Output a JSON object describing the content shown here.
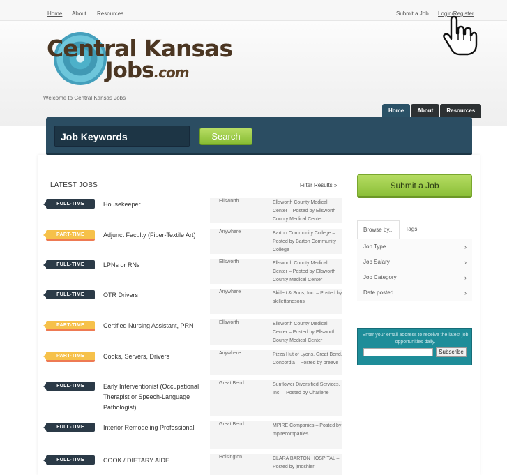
{
  "top_nav": {
    "home": "Home",
    "about": "About",
    "resources": "Resources",
    "submit_job": "Submit a Job",
    "login_register": "Login/Register"
  },
  "logo": {
    "line1": "Central Kansas",
    "line2": "Jobs",
    "suffix": ".com"
  },
  "welcome": "Welcome to Central Kansas Jobs",
  "tabs": {
    "home": "Home",
    "about": "About",
    "resources": "Resources"
  },
  "search": {
    "placeholder": "Job Keywords",
    "button": "Search"
  },
  "latest_jobs": {
    "heading": "LATEST JOBS",
    "filter": "Filter Results »"
  },
  "jobs": [
    {
      "type": "FULL-TIME",
      "title": "Housekeeper",
      "location": "Ellsworth",
      "meta": "Ellsworth County Medical Center – Posted by Ellsworth County Medical Center"
    },
    {
      "type": "PART-TIME",
      "title": "Adjunct Faculty (Fiber-Textile Art)",
      "location": "Anywhere",
      "meta": "Barton Community College – Posted by Barton Community College"
    },
    {
      "type": "FULL-TIME",
      "title": "LPNs or RNs",
      "location": "Ellsworth",
      "meta": "Ellsworth County Medical Center – Posted by Ellsworth County Medical Center"
    },
    {
      "type": "FULL-TIME",
      "title": "OTR Drivers",
      "location": "Anywhere",
      "meta": "Skillett & Sons, Inc. – Posted by skillettandsons"
    },
    {
      "type": "PART-TIME",
      "title": "Certified Nursing Assistant, PRN",
      "location": "Ellsworth",
      "meta": "Ellsworth County Medical Center – Posted by Ellsworth County Medical Center"
    },
    {
      "type": "PART-TIME",
      "title": "Cooks, Servers, Drivers",
      "location": "Anywhere",
      "meta": "Pizza Hut of Lyons, Great Bend, Concordia – Posted by preeve"
    },
    {
      "type": "FULL-TIME",
      "title": "Early Interventionist (Occupational Therapist or Speech-Language Pathologist)",
      "location": "Great Bend",
      "meta": "Sunflower Diversified Services, Inc. – Posted by Charlene"
    },
    {
      "type": "FULL-TIME",
      "title": "Interior Remodeling Professional",
      "location": "Great Bend",
      "meta": "MPIRE Companies – Posted by mpirecompanies"
    },
    {
      "type": "FULL-TIME",
      "title": "COOK / DIETARY AIDE",
      "location": "Hoisington",
      "meta": "CLARA BARTON HOSPITAL – Posted by jmoshier"
    }
  ],
  "sidebar": {
    "submit_button": "Submit a Job",
    "browse_tab": "Browse by...",
    "tags_tab": "Tags",
    "browse_items": [
      "Job Type",
      "Job Salary",
      "Job Category",
      "Date posted"
    ],
    "chevron": "›",
    "newsletter_text": "Enter your email address to receive the latest job opportunities daily.",
    "subscribe": "Subscribe"
  },
  "icons": {
    "cursor": "hand-pointer-icon",
    "flower": "flower-logo-icon"
  },
  "colors": {
    "search_bar": "#2b4d62",
    "accent_green": "#8bbf38",
    "fulltime": "#2b3a47",
    "parttime": "#f6c14a",
    "newsletter": "#1e8d99"
  }
}
